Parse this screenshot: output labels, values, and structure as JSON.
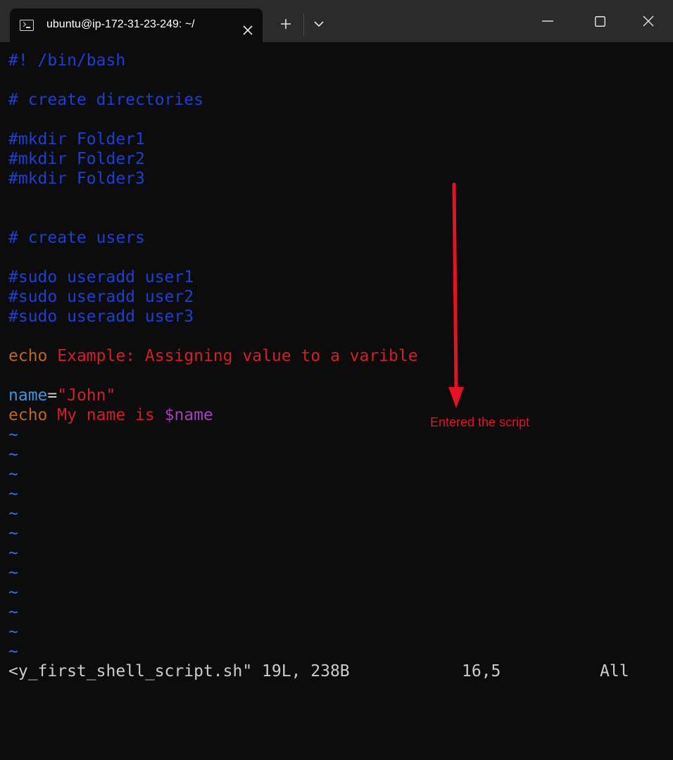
{
  "window": {
    "tab_title": "ubuntu@ip-172-31-23-249: ~/",
    "icons": {
      "tab": "terminal-icon",
      "tab_close": "close-icon",
      "new_tab": "plus-icon",
      "dropdown": "chevron-down-icon",
      "minimize": "minimize-icon",
      "maximize": "maximize-icon",
      "close": "close-icon"
    }
  },
  "editor": {
    "lines": {
      "l1": "#! /bin/bash",
      "l3": "# create directories",
      "l5": "#mkdir Folder1",
      "l6": "#mkdir Folder2",
      "l7": "#mkdir Folder3",
      "l10": "# create users",
      "l12": "#sudo useradd user1",
      "l13": "#sudo useradd user2",
      "l14": "#sudo useradd user3",
      "l16_cmd": "echo",
      "l16_text": "Example: Assigning value to a varible",
      "l18_var": "name",
      "l18_eq": "=",
      "l18_val": "\"John\"",
      "l19_cmd": "echo",
      "l19_text": "My name is",
      "l19_var": "$name"
    },
    "tilde": "~",
    "status": {
      "file_info": "<y_first_shell_script.sh\" 19L, 238B",
      "cursor_pos": "16,5",
      "scroll": "All"
    }
  },
  "annotation": {
    "label": "Entered the script",
    "color": "#e81123"
  },
  "colors": {
    "background": "#0c0c0c",
    "titlebar": "#2b2b2b",
    "comment": "#1e3fd4",
    "keyword": "#c2661a",
    "string": "#d21f2a",
    "variable": "#3a96dd",
    "dollar_var": "#a33fb8",
    "tilde": "#3b6ee6"
  }
}
